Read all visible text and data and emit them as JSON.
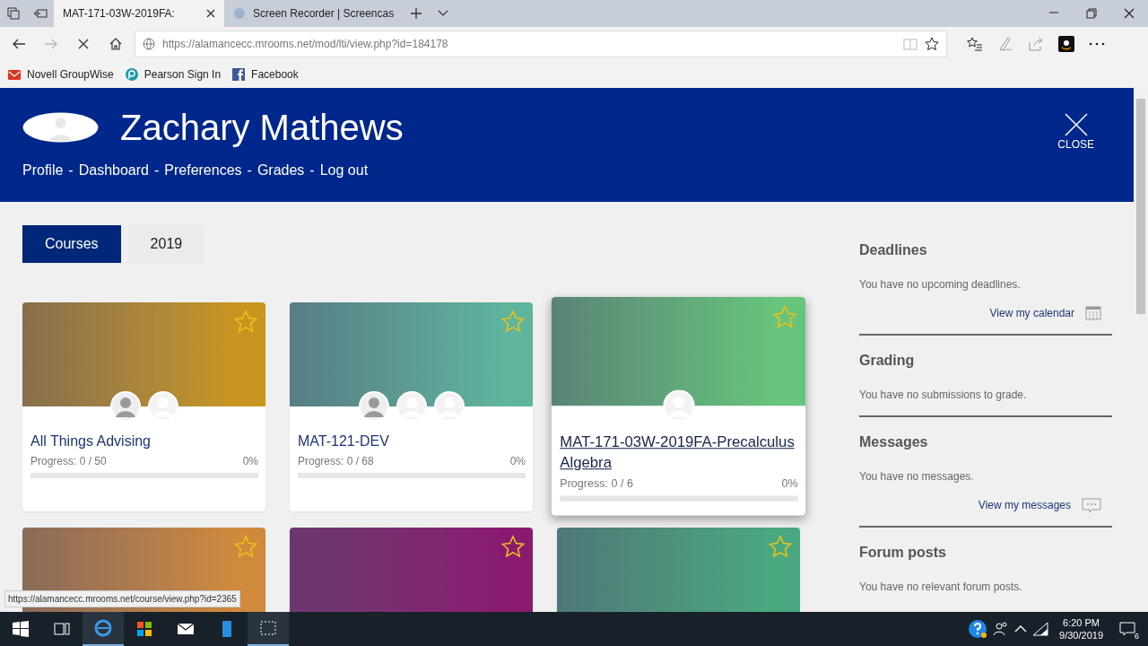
{
  "browser": {
    "tabs": [
      {
        "label": "MAT-171-03W-2019FA:",
        "selected": true
      },
      {
        "label": "Screen Recorder | Screencas",
        "selected": false
      }
    ],
    "address": "https://alamancecc.mrooms.net/mod/lti/view.php?id=184178",
    "forward_disabled": true,
    "favorites": [
      {
        "label": "Novell GroupWise",
        "kind": "mail"
      },
      {
        "label": "Pearson Sign In",
        "kind": "pearson"
      },
      {
        "label": "Facebook",
        "kind": "facebook"
      }
    ],
    "status_url": "https://alamancecc.mrooms.net/course/view.php?id=2365"
  },
  "header": {
    "name": "Zachary Mathews",
    "links": [
      "Profile",
      "Dashboard",
      "Preferences",
      "Grades",
      "Log out"
    ],
    "separator": "-",
    "close_label": "CLOSE"
  },
  "course_tabs": [
    {
      "label": "Courses",
      "selected": true
    },
    {
      "label": "2019",
      "selected": false
    }
  ],
  "cards": [
    {
      "title": "All Things Advising",
      "progress": "Progress: 0 / 50",
      "percent": "0%",
      "level": 0,
      "starred": false,
      "hovered": false,
      "color": "#c8961e",
      "avatars": [
        {
          "kind": "photo"
        },
        {
          "kind": "default"
        }
      ]
    },
    {
      "title": "MAT-121-DEV",
      "progress": "Progress: 0 / 68",
      "percent": "0%",
      "level": 0,
      "starred": false,
      "hovered": false,
      "color": "#5fb49e",
      "avatars": [
        {
          "kind": "photo"
        },
        {
          "kind": "default"
        },
        {
          "kind": "default"
        }
      ]
    },
    {
      "title": "MAT-171-03W-2019FA-Precalculus Algebra",
      "progress": "Progress: 0 / 6",
      "percent": "0%",
      "level": 0,
      "starred": false,
      "hovered": true,
      "color": "#66c47c",
      "avatars": [
        {
          "kind": "default"
        }
      ]
    },
    {
      "starred": false,
      "hovered": false,
      "color": "#d08a3c"
    },
    {
      "starred": false,
      "hovered": false,
      "color": "#8a1a70"
    },
    {
      "starred": false,
      "hovered": false,
      "color": "#4aa880"
    }
  ],
  "sidebar": [
    {
      "title": "Deadlines",
      "message": "You have no upcoming deadlines.",
      "link": "View my calendar",
      "kind": "calendar"
    },
    {
      "title": "Grading",
      "message": "You have no submissions to grade."
    },
    {
      "title": "Messages",
      "message": "You have no messages.",
      "link": "View my messages",
      "kind": "chat"
    },
    {
      "title": "Forum posts",
      "message": "You have no relevant forum posts."
    }
  ],
  "taskbar": {
    "time": "6:20 PM",
    "date": "9/30/2019",
    "notifications": "6"
  }
}
